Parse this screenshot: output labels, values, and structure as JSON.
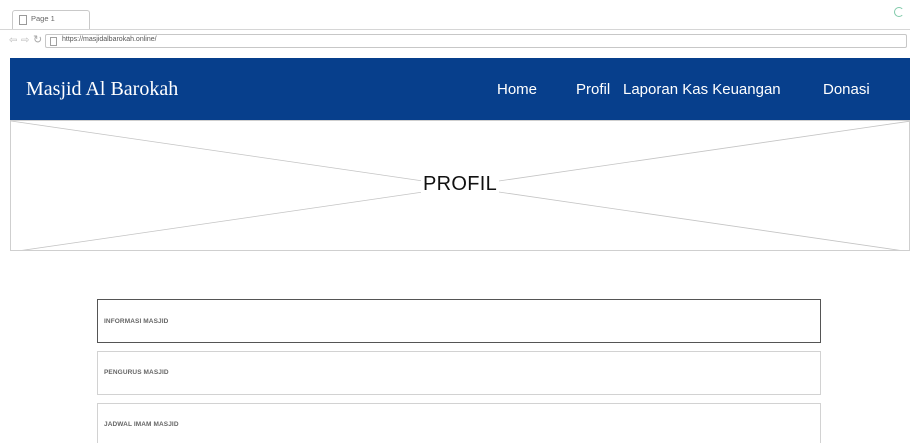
{
  "browser": {
    "tab_title": "Page 1",
    "url": "https://masjidalbarokah.online/",
    "icons": {
      "back": "back-arrow-icon",
      "forward": "forward-arrow-icon",
      "reload": "reload-icon",
      "loading": "loading-spinner-icon"
    }
  },
  "header": {
    "site_title": "Masjid Al Barokah",
    "nav": [
      "Home",
      "Profil",
      "Laporan Kas Keuangan",
      "Donasi"
    ],
    "background_color": "#073f8c"
  },
  "hero": {
    "title": "PROFIL"
  },
  "panels": [
    {
      "label": "INFORMASI MASJID"
    },
    {
      "label": "PENGURUS MASJID"
    },
    {
      "label": "JADWAL IMAM MASJID"
    }
  ]
}
